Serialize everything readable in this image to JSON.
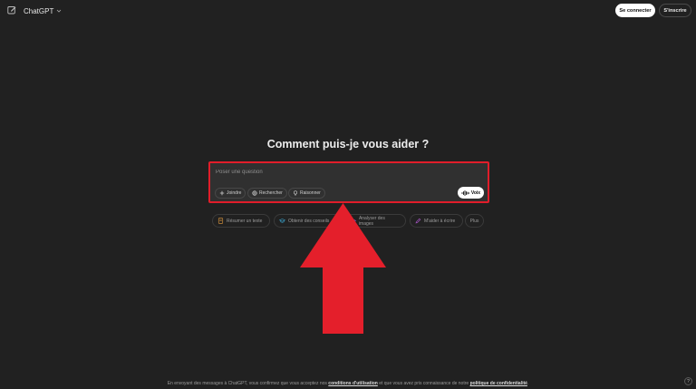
{
  "header": {
    "model_label": "ChatGPT",
    "login_label": "Se connecter",
    "signup_label": "S'inscrire"
  },
  "main": {
    "title": "Comment puis-je vous aider ?"
  },
  "composer": {
    "placeholder": "Poser une question",
    "attach_label": "Joindre",
    "search_label": "Rechercher",
    "reason_label": "Raisonner",
    "voice_label": "Voix"
  },
  "suggestions": [
    {
      "label": "Résumer un texte",
      "icon": "document-icon",
      "color": "#c98a3a"
    },
    {
      "label": "Obtenir des conseils",
      "icon": "graduation-cap-icon",
      "color": "#3aa0c9"
    },
    {
      "label": "Analyser des images",
      "icon": "eye-icon",
      "color": "#8a5bd6"
    },
    {
      "label": "M'aider à écrire",
      "icon": "pen-icon",
      "color": "#b35bd6"
    },
    {
      "label": "Plus",
      "icon": "",
      "color": ""
    }
  ],
  "footer": {
    "text_before": "En envoyant des messages à ChatGPT, vous confirmez que vous acceptez nos ",
    "terms_link": "conditions d'utilisation",
    "text_middle": " et que vous avez pris connaissance de notre ",
    "privacy_link": "politique de confidentialité",
    "text_after": ".",
    "help_label": "?"
  },
  "colors": {
    "background": "#212121",
    "composer_bg": "#303030",
    "highlight_red": "#e11d2a"
  }
}
